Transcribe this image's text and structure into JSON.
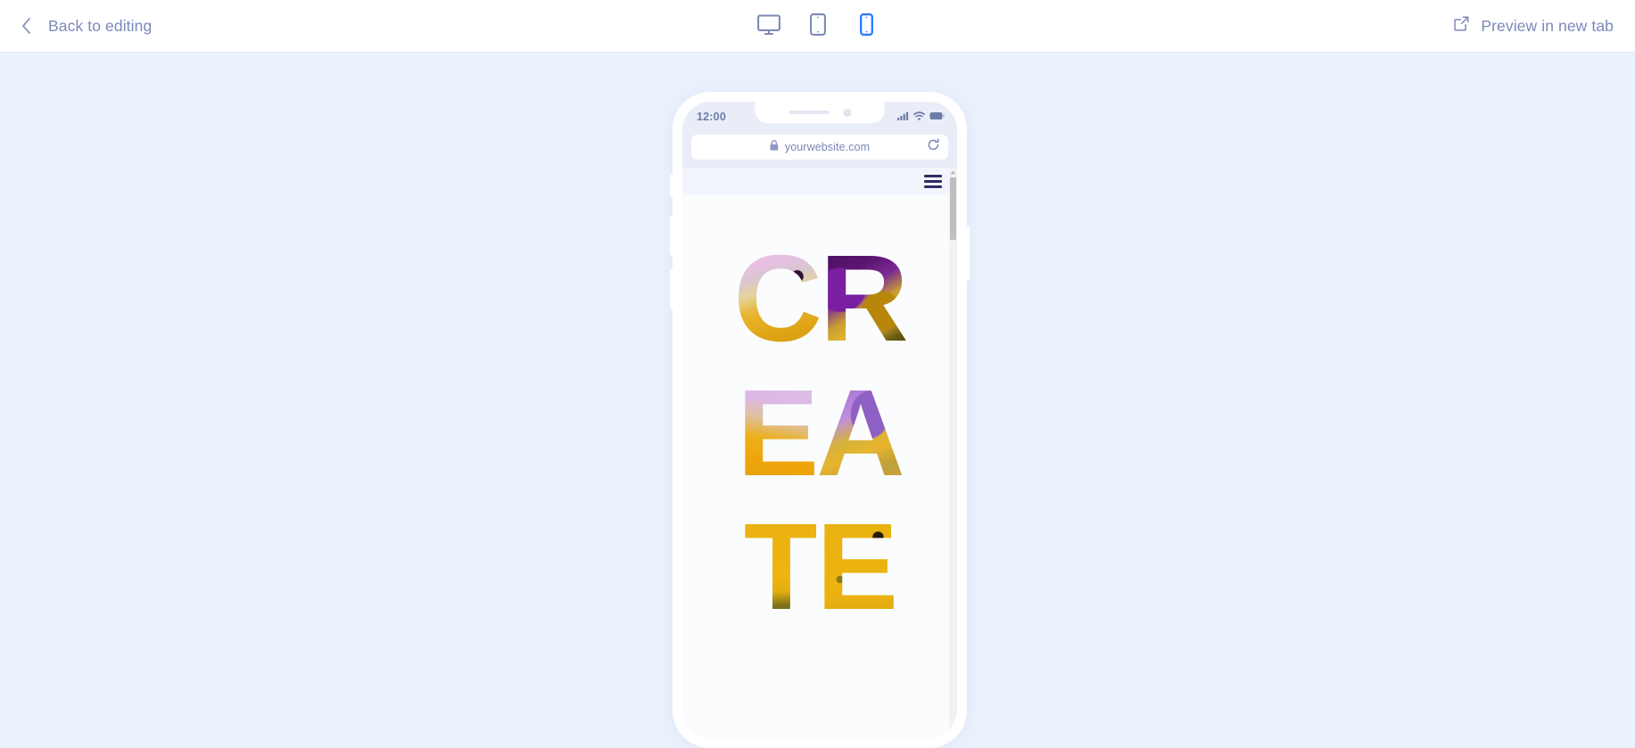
{
  "topbar": {
    "back_label": "Back to editing",
    "back_icon": "chevron-left-icon",
    "preview_label": "Preview in new tab",
    "preview_icon": "external-link-icon",
    "devices": [
      {
        "name": "desktop",
        "icon": "desktop-icon",
        "active": false
      },
      {
        "name": "tablet",
        "icon": "tablet-icon",
        "active": false
      },
      {
        "name": "mobile",
        "icon": "mobile-icon",
        "active": true
      }
    ],
    "active_device": "mobile"
  },
  "colors": {
    "canvas_bg": "#ebf1fd",
    "topbar_bg": "#ffffff",
    "muted_text": "#7c89ba",
    "active_accent": "#2979ff",
    "inactive_icon": "#7d8ab9",
    "status_bar_bg": "#e9edf7",
    "site_nav_bg": "#f2f5fc",
    "burger_color": "#2f2d63",
    "scrollbar_thumb": "#bfbfbf"
  },
  "phone": {
    "status_bar": {
      "time": "12:00",
      "signal_icon": "signal-bars-icon",
      "wifi_icon": "wifi-icon",
      "battery_icon": "battery-icon",
      "speaker_name": "earpiece-speaker",
      "camera_name": "front-camera"
    },
    "browser": {
      "lock_icon": "padlock-icon",
      "url": "yourwebsite.com",
      "reload_icon": "reload-icon"
    },
    "site": {
      "menu_icon": "hamburger-menu-icon",
      "hero_rows": [
        {
          "letters": [
            "C",
            "R"
          ],
          "fills": [
            "tex-c",
            "tex-r"
          ]
        },
        {
          "letters": [
            "E",
            "A"
          ],
          "fills": [
            "tex-e",
            "tex-a"
          ]
        },
        {
          "letters": [
            "T",
            "E"
          ],
          "fills": [
            "tex-t",
            "tex-e2"
          ]
        }
      ],
      "hero_word": "CREATE"
    },
    "scrollbar": {
      "up_arrow_icon": "scroll-up-arrow-icon",
      "thumb_name": "scrollbar-thumb"
    }
  }
}
